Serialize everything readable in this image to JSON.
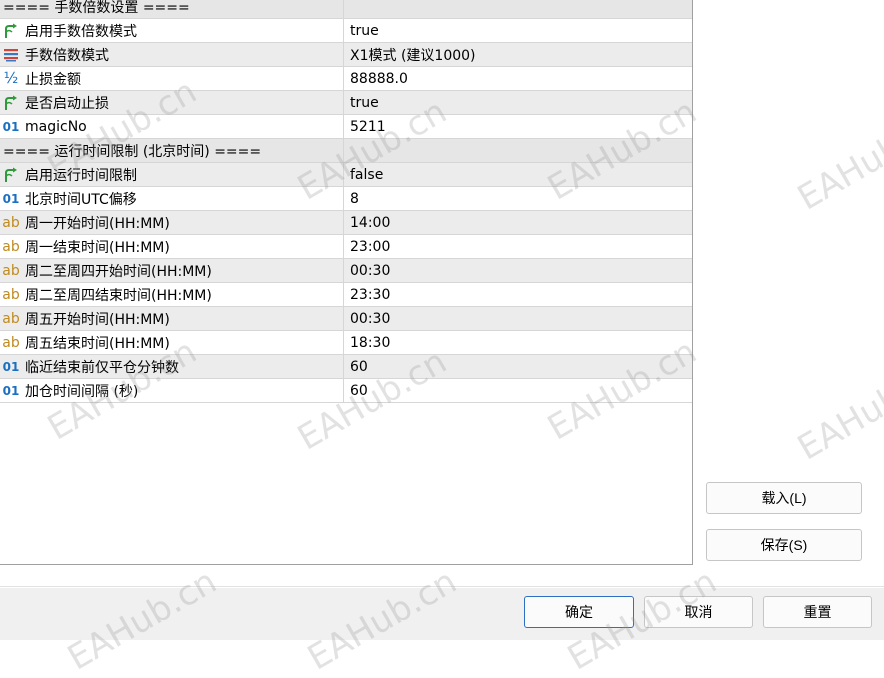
{
  "grid": {
    "rows": [
      {
        "type": "section",
        "label": "==== 手数倍数设置 ===="
      },
      {
        "type": "prop",
        "icon": "bool-arrow-icon",
        "name": "启用手数倍数模式",
        "value": "true"
      },
      {
        "type": "prop",
        "icon": "enum-list-icon",
        "name": "手数倍数模式",
        "value": "X1模式 (建议1000)"
      },
      {
        "type": "prop",
        "icon": "double-half-icon",
        "name": "止损金额",
        "value": "88888.0"
      },
      {
        "type": "prop",
        "icon": "bool-arrow-icon",
        "name": "是否启动止损",
        "value": "true"
      },
      {
        "type": "prop",
        "icon": "integer-01-icon",
        "name": "magicNo",
        "value": "5211"
      },
      {
        "type": "section",
        "label": "==== 运行时间限制 (北京时间) ===="
      },
      {
        "type": "prop",
        "icon": "bool-arrow-icon",
        "name": "启用运行时间限制",
        "value": "false"
      },
      {
        "type": "prop",
        "icon": "integer-01-icon",
        "name": "北京时间UTC偏移",
        "value": "8"
      },
      {
        "type": "prop",
        "icon": "string-ab-icon",
        "name": "周一开始时间(HH:MM)",
        "value": "14:00"
      },
      {
        "type": "prop",
        "icon": "string-ab-icon",
        "name": "周一结束时间(HH:MM)",
        "value": "23:00"
      },
      {
        "type": "prop",
        "icon": "string-ab-icon",
        "name": "周二至周四开始时间(HH:MM)",
        "value": "00:30"
      },
      {
        "type": "prop",
        "icon": "string-ab-icon",
        "name": "周二至周四结束时间(HH:MM)",
        "value": "23:30"
      },
      {
        "type": "prop",
        "icon": "string-ab-icon",
        "name": "周五开始时间(HH:MM)",
        "value": "00:30"
      },
      {
        "type": "prop",
        "icon": "string-ab-icon",
        "name": "周五结束时间(HH:MM)",
        "value": "18:30"
      },
      {
        "type": "prop",
        "icon": "integer-01-icon",
        "name": "临近结束前仅平仓分钟数",
        "value": "60"
      },
      {
        "type": "prop",
        "icon": "integer-01-icon",
        "name": "加仓时间间隔 (秒)",
        "value": "60"
      }
    ]
  },
  "side": {
    "load_label": "载入(L)",
    "save_label": "保存(S)"
  },
  "footer": {
    "ok_label": "确定",
    "cancel_label": "取消",
    "reset_label": "重置"
  },
  "watermark": "EAHub.cn",
  "colors": {
    "accent": "#2d6fc4",
    "icon_green": "#2e9b3a",
    "icon_blue": "#1a6fc0",
    "icon_orange": "#c08a1e"
  }
}
